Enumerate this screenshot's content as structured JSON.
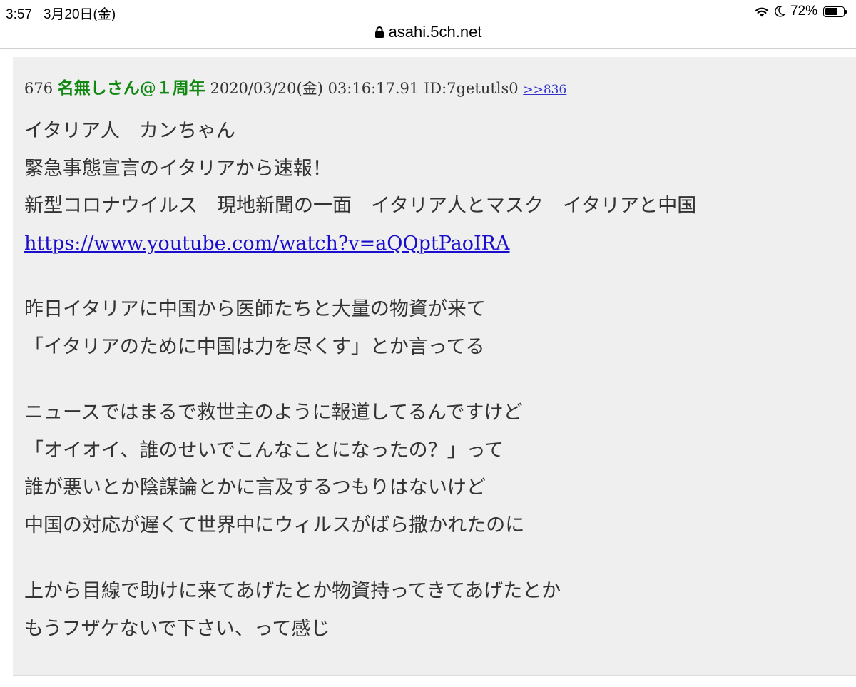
{
  "status_bar": {
    "time": "3:57",
    "date": "3月20日(金)",
    "battery_percent": "72%",
    "battery_level": 0.72
  },
  "browser": {
    "url": "asahi.5ch.net"
  },
  "post": {
    "number": "676",
    "name": "名無しさん@１周年",
    "datetime": "2020/03/20(金) 03:16:17.91",
    "id": "ID:7getutls0",
    "reply_ref": ">>836",
    "paragraphs": [
      [
        "イタリア人　カンちゃん",
        "緊急事態宣言のイタリアから速報！",
        "新型コロナウイルス　現地新聞の一面　イタリア人とマスク　イタリアと中国"
      ],
      [
        "昨日イタリアに中国から医師たちと大量の物資が来て",
        "「イタリアのために中国は力を尽くす」とか言ってる"
      ],
      [
        "ニュースではまるで救世主のように報道してるんですけど",
        "「オイオイ、誰のせいでこんなことになったの？」って",
        "誰が悪いとか陰謀論とかに言及するつもりはないけど",
        "中国の対応が遅くて世界中にウィルスがばら撒かれたのに"
      ],
      [
        "上から目線で助けに来てあげたとか物資持ってきてあげたとか",
        "もうフザケないで下さい、って感じ"
      ]
    ],
    "link": "https://www.youtube.com/watch?v=aQQptPaoIRA"
  },
  "icons": {
    "wifi": "wifi-icon",
    "moon": "moon-icon",
    "battery": "battery-icon",
    "lock": "lock-icon"
  },
  "colors": {
    "name": "#118811",
    "link": "#1a0dcc",
    "reply": "#3333cc",
    "post_background": "#efefef"
  }
}
